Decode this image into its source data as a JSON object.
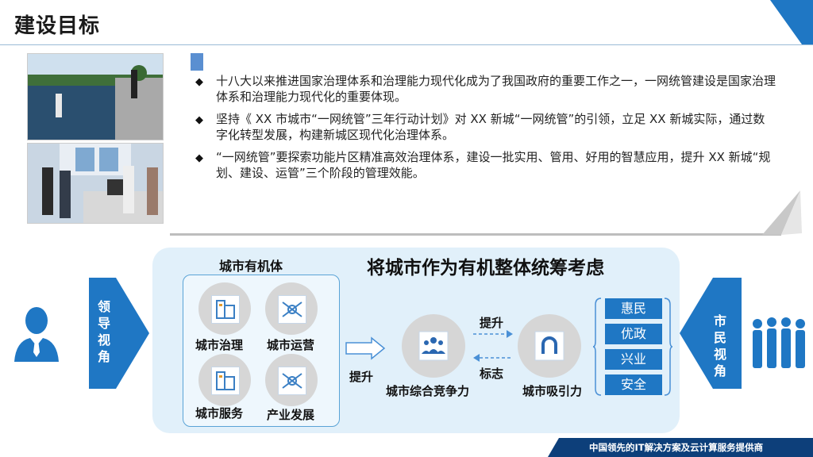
{
  "header": {
    "title": "建设目标"
  },
  "bullets": [
    "十八大以来推进国家治理体系和治理能力现代化成为了我国政府的重要工作之一，一网统管建设是国家治理体系和治理能力现代化的重要体现。",
    "坚持《 XX 市城市“一网统管”三年行动计划》对 XX 新城“一网统管”的引领，立足 XX 新城实际，通过数字化转型发展，构建新城区现代化治理体系。",
    "“一网统管”要探索功能片区精准高效治理体系，建设一批实用、管用、好用的智慧应用，提升 XX 新城“规划、建设、运管”三个阶段的管理效能。"
  ],
  "diagram": {
    "main_title": "将城市作为有机整体统筹考虑",
    "organic": {
      "title": "城市有机体",
      "items": [
        "城市治理",
        "城市运营",
        "城市服务",
        "产业发展"
      ]
    },
    "arrow_label": "提升",
    "competitiveness": "城市综合竞争力",
    "attraction": "城市吸引力",
    "upper_label": "提升",
    "lower_label": "标志",
    "benefits": [
      "惠民",
      "优政",
      "兴业",
      "安全"
    ],
    "left_view": [
      "领",
      "导",
      "视",
      "角"
    ],
    "right_view": [
      "市",
      "民",
      "视",
      "角"
    ]
  },
  "footer": {
    "text": "中国领先的IT解决方案及云计算服务提供商"
  },
  "colors": {
    "accent": "#1f77c4",
    "panel": "#e1f0fa",
    "footer": "#0d3f7a"
  },
  "icons": [
    "building-icon",
    "puzzle-hands-icon",
    "people-group-icon",
    "magnet-icon",
    "leader-avatar-icon",
    "citizens-group-icon"
  ]
}
